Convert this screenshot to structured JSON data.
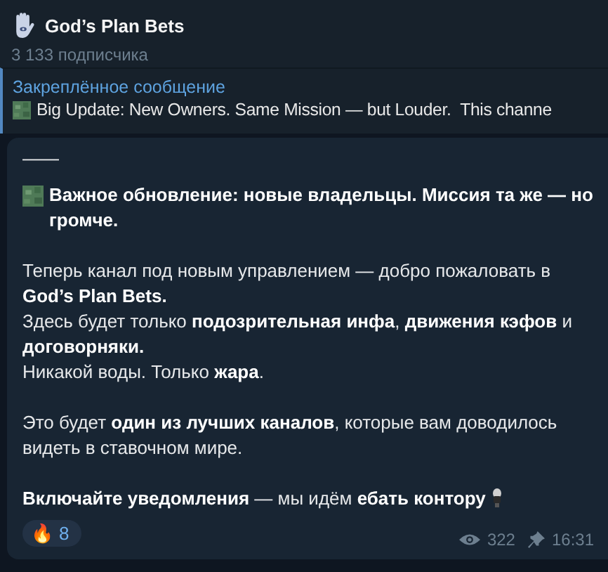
{
  "header": {
    "title": "God’s Plan Bets",
    "subscribers": "3 133 подписчика"
  },
  "pinned": {
    "label": "Закреплённое сообщение",
    "text": "Big Update: New Owners. Same Mission — but Louder.  This channe"
  },
  "message": {
    "separator": "——",
    "paragraphs": [
      {
        "kind": "emoji_lead",
        "lines": [
          "**Важное обновление: новые владельцы. Миссия та же — но громче.**"
        ]
      },
      {
        "kind": "text",
        "lines": [
          "Теперь канал под новым управлением — добро пожаловать в **God’s Plan Bets.**",
          "Здесь будет только **подозрительная инфа**, **движения кэфов** и **договорняки.**",
          "Никакой воды. Только **жара**."
        ]
      },
      {
        "kind": "text",
        "lines": [
          "Это будет **один из лучших каналов**, которые вам доводилось видеть в ставочном мире."
        ]
      },
      {
        "kind": "emoji_tail",
        "lines": [
          "**Включайте уведомления** — мы идём **ебать контору**"
        ]
      }
    ],
    "reaction": {
      "emoji": "🔥",
      "count": "8"
    },
    "views": "322",
    "time": "16:31"
  }
}
